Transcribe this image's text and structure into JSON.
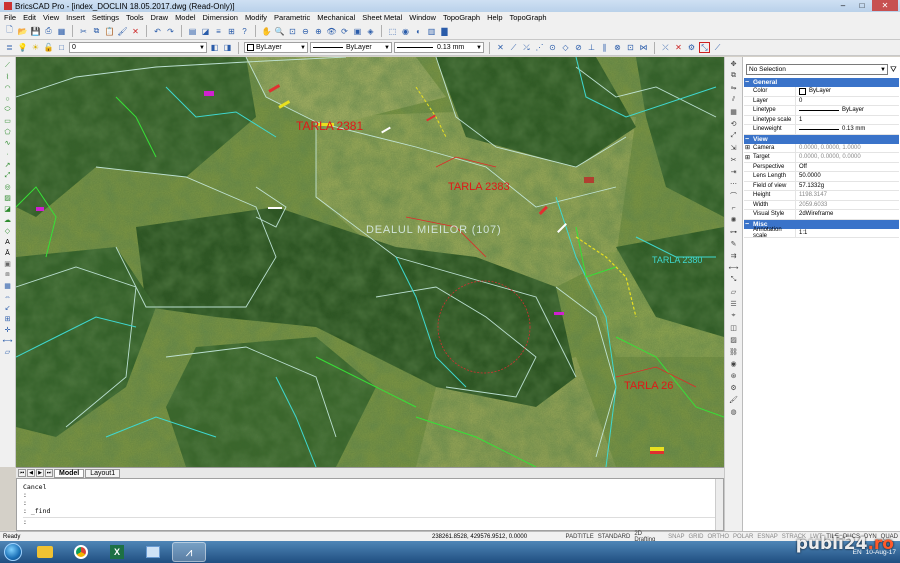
{
  "window": {
    "title": "BricsCAD Pro - [index_DOCLIN 18.05.2017.dwg (Read-Only)]"
  },
  "menu": [
    "File",
    "Edit",
    "View",
    "Insert",
    "Settings",
    "Tools",
    "Draw",
    "Model",
    "Dimension",
    "Modify",
    "Parametric",
    "Mechanical",
    "Sheet Metal",
    "Window",
    "TopoGraph",
    "Help",
    "TopoGraph"
  ],
  "layer_toolbar": {
    "layer_value": "0",
    "color_value": "ByLayer",
    "linetype_value": "ByLayer",
    "lineweight_value": "0.13 mm"
  },
  "map": {
    "labels": [
      "TARLA 2381",
      "TARLA 2383",
      "DEALUL MIEILOR (107)",
      "TARLA 2380",
      "TARLA 26"
    ],
    "colors": {
      "parcel_line": "#bfe8e0",
      "forest": "#2f5a24",
      "field": "#7f9a45",
      "cyan": "#3fd8d0",
      "green": "#37e037",
      "red_text": "#e01818",
      "magenta": "#d020d0"
    }
  },
  "tabs": {
    "model": "Model",
    "layout": "Layout1"
  },
  "command_line": [
    "Cancel",
    ":",
    ":",
    ": _find",
    ":"
  ],
  "properties": {
    "selection": "No Selection",
    "groups": [
      {
        "name": "General",
        "rows": [
          {
            "key": "Color",
            "value": "ByLayer"
          },
          {
            "key": "Layer",
            "value": "0"
          },
          {
            "key": "Linetype",
            "value": "ByLayer"
          },
          {
            "key": "Linetype scale",
            "value": "1"
          },
          {
            "key": "Lineweight",
            "value": "0.13 mm"
          }
        ]
      },
      {
        "name": "View",
        "rows": [
          {
            "key": "Camera",
            "value": "0.0000, 0.0000, 1.0000"
          },
          {
            "key": "Target",
            "value": "0.0000, 0.0000, 0.0000"
          },
          {
            "key": "Perspective",
            "value": "Off"
          },
          {
            "key": "Lens Length",
            "value": "50.0000"
          },
          {
            "key": "Field of view",
            "value": "57.1332g"
          },
          {
            "key": "Height",
            "value": "1198.3147"
          },
          {
            "key": "Width",
            "value": "2059.6033"
          },
          {
            "key": "Visual Style",
            "value": "2dWireframe"
          }
        ]
      },
      {
        "name": "Misc",
        "rows": [
          {
            "key": "Annotation scale",
            "value": "1:1"
          }
        ]
      }
    ]
  },
  "status": {
    "ready": "Ready",
    "coords": "238261.8528, 429576.9512, 0.0000",
    "items": [
      "PADTITLE",
      "STANDARD",
      "2D Drafting",
      "SNAP",
      "GRID",
      "ORTHO",
      "POLAR",
      "ESNAP",
      "STRACK",
      "LWT",
      "TILE",
      "DUCS",
      "DYN",
      "QUAD"
    ]
  },
  "taskbar": {
    "lang": "EN",
    "time": "",
    "date": "10-Aug-17"
  },
  "watermark": {
    "main": "publi24",
    "tld": ".ro"
  }
}
